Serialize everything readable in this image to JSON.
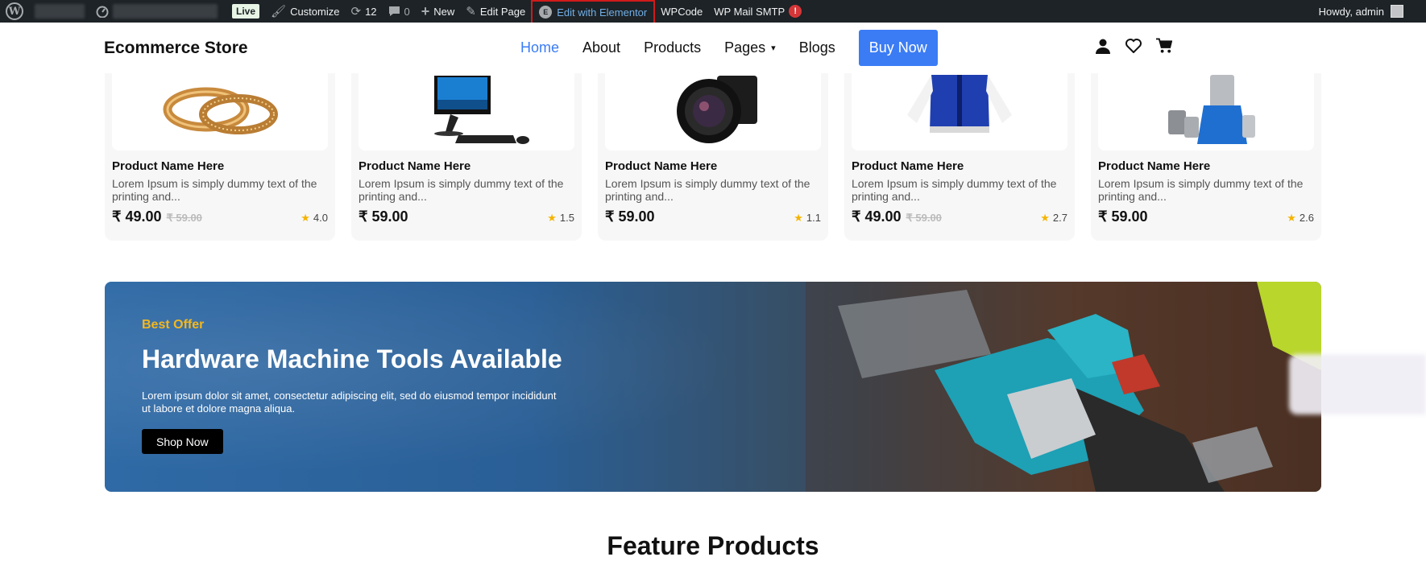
{
  "admin_bar": {
    "live_label": "Live",
    "customize_label": "Customize",
    "updates_count": "12",
    "comments_count": "0",
    "new_label": "New",
    "edit_page_label": "Edit Page",
    "edit_elementor_label": "Edit with Elementor",
    "wpcode_label": "WPCode",
    "wp_mail_smtp_label": "WP Mail SMTP",
    "smtp_alert": "!",
    "greeting": "Howdy, admin"
  },
  "header": {
    "brand": "Ecommerce Store",
    "nav": {
      "home": "Home",
      "about": "About",
      "products": "Products",
      "pages": "Pages",
      "blogs": "Blogs",
      "buy_now": "Buy Now"
    }
  },
  "products": [
    {
      "name": "Product Name Here",
      "desc": "Lorem Ipsum is simply dummy text of the printing and...",
      "price": "₹ 49.00",
      "old_price": "₹ 59.00",
      "rating": "4.0",
      "image": "gold-rings"
    },
    {
      "name": "Product Name Here",
      "desc": "Lorem Ipsum is simply dummy text of the printing and...",
      "price": "₹ 59.00",
      "old_price": "",
      "rating": "1.5",
      "image": "all-in-one-computer"
    },
    {
      "name": "Product Name Here",
      "desc": "Lorem Ipsum is simply dummy text of the printing and...",
      "price": "₹ 59.00",
      "old_price": "",
      "rating": "1.1",
      "image": "camera"
    },
    {
      "name": "Product Name Here",
      "desc": "Lorem Ipsum is simply dummy text of the printing and...",
      "price": "₹ 49.00",
      "old_price": "₹ 59.00",
      "rating": "2.7",
      "image": "jacket"
    },
    {
      "name": "Product Name Here",
      "desc": "Lorem Ipsum is simply dummy text of the printing and...",
      "price": "₹ 59.00",
      "old_price": "",
      "rating": "2.6",
      "image": "mixer-grinder"
    }
  ],
  "banner": {
    "eyebrow": "Best Offer",
    "title": "Hardware Machine Tools Available",
    "text": "Lorem ipsum dolor sit amet, consectetur adipiscing elit, sed do eiusmod tempor incididunt ut labore et dolore magna aliqua.",
    "button": "Shop Now"
  },
  "section_heading": "Feature Products",
  "colors": {
    "accent": "#3b7cf5",
    "admin_bar": "#1d2327",
    "offer": "#f4b71d",
    "star": "#f5b400",
    "highlight_box": "#d11a1a"
  }
}
